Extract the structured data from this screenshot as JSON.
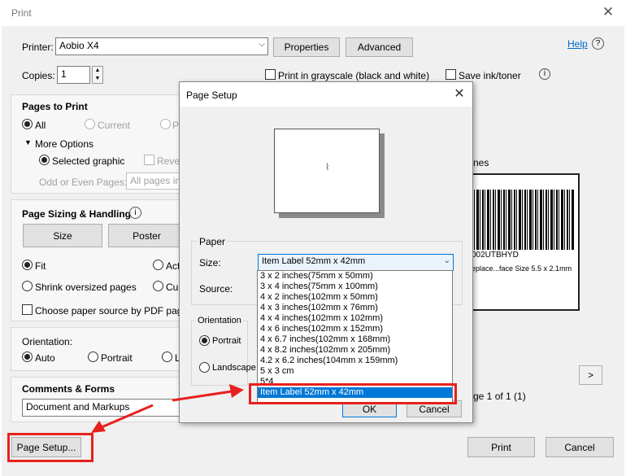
{
  "window": {
    "title": "Print",
    "close": "✕"
  },
  "printer": {
    "label": "Printer:",
    "value": "Aobio X4",
    "properties": "Properties",
    "advanced": "Advanced",
    "help": "Help",
    "help_icon": "?"
  },
  "copies": {
    "label": "Copies:",
    "value": "1",
    "grayscale": "Print in grayscale (black and white)",
    "save_ink": "Save ink/toner",
    "info_icon": "i"
  },
  "pages": {
    "title": "Pages to Print",
    "all": "All",
    "current": "Current",
    "pages_cut": "Pa",
    "more_options": "More Options",
    "selected_graphic": "Selected graphic",
    "reverse_cut": "Rever",
    "odd_even_label": "Odd or Even Pages:",
    "odd_even_value": "All pages in"
  },
  "sizing": {
    "title": "Page Sizing & Handling",
    "size": "Size",
    "poster": "Poster",
    "fit": "Fit",
    "actual_cut": "Act",
    "shrink": "Shrink oversized pages",
    "custom_cut": "Cus",
    "choose_source": "Choose paper source by PDF page"
  },
  "orientation": {
    "label": "Orientation:",
    "auto": "Auto",
    "portrait": "Portrait",
    "landscape_cut": "L"
  },
  "comments": {
    "title": "Comments & Forms",
    "value": "Document and Markups"
  },
  "preview": {
    "header_cut": "nes",
    "barcode_id": "002UTBHYD",
    "barcode_desc": "eplace...face Size 5.5 x 2.1mm",
    "next": ">",
    "page_count": "ge 1 of 1 (1)"
  },
  "footer": {
    "page_setup": "Page Setup...",
    "print": "Print",
    "cancel": "Cancel"
  },
  "page_setup": {
    "title": "Page Setup",
    "close": "✕",
    "paper_group": "Paper",
    "size_label": "Size:",
    "size_value": "Item Label 52mm x 42mm",
    "source_label": "Source:",
    "orientation_group": "Orientation",
    "portrait": "Portrait",
    "landscape": "Landscape",
    "ok": "OK",
    "cancel": "Cancel",
    "options": [
      "3 x 2 inches(75mm x 50mm)",
      "3 x 4 inches(75mm x 100mm)",
      "4 x 2 inches(102mm x 50mm)",
      "4 x 3 inches(102mm x 76mm)",
      "4 x 4 inches(102mm x 102mm)",
      "4 x 6 inches(102mm x 152mm)",
      "4 x 6.7 inches(102mm x 168mm)",
      "4 x 8.2 inches(102mm x 205mm)",
      "4.2 x 6.2 inches(104mm x 159mm)",
      "5 x 3 cm",
      "5*4",
      "Item Label 52mm x 42mm"
    ],
    "selected_index": 11
  },
  "colors": {
    "accent": "#0078d7",
    "highlight": "#e8201e",
    "link": "#0066cc"
  }
}
